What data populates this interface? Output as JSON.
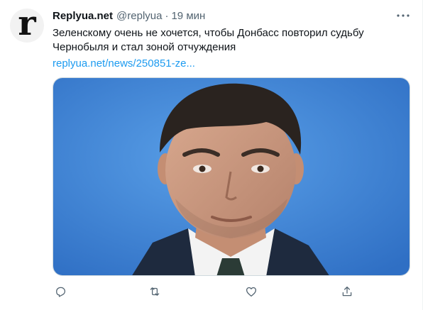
{
  "author": {
    "display_name": "Replyua.net",
    "handle": "@replyua",
    "separator": "·",
    "timestamp": "19 мин",
    "avatar_letter": "r"
  },
  "tweet": {
    "text": "Зеленскому очень не хочется, чтобы Донбасс повторил судьбу Чернобыля и стал зоной отчуждения",
    "link_text": "replyua.net/news/250851-ze..."
  },
  "media": {
    "type": "photo",
    "background_color": "#3a7fd0"
  },
  "actions": [
    {
      "name": "reply",
      "icon": "reply-icon"
    },
    {
      "name": "retweet",
      "icon": "retweet-icon"
    },
    {
      "name": "like",
      "icon": "heart-icon"
    },
    {
      "name": "share",
      "icon": "share-icon"
    }
  ],
  "colors": {
    "text": "#0f1419",
    "secondary": "#536471",
    "link": "#1d9bf0"
  }
}
